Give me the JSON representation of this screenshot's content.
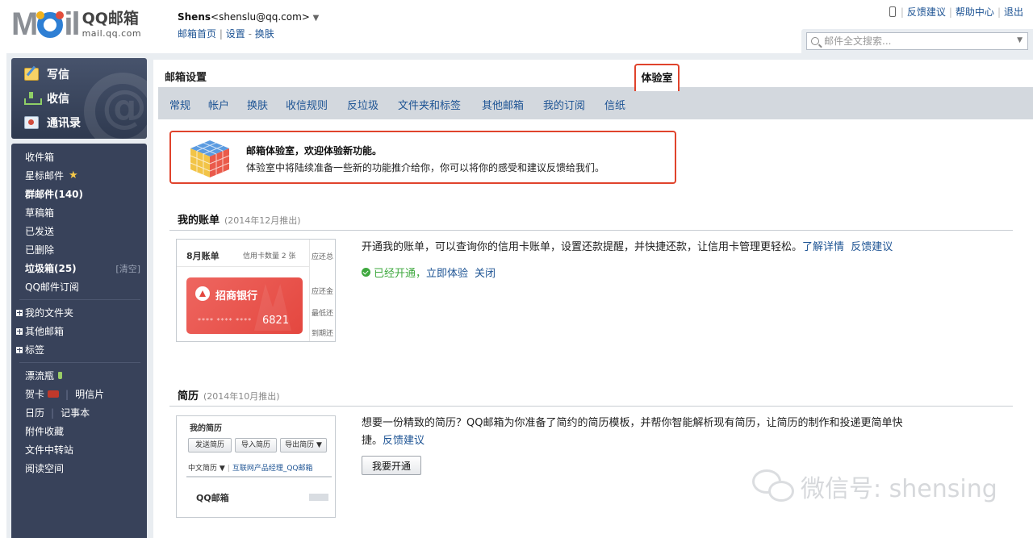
{
  "header": {
    "logo_mark": "M il",
    "logo_cn": "QQ邮箱",
    "logo_domain": "mail.qq.com",
    "user_name": "Shens",
    "user_email": "<shenslu@qq.com>",
    "user_arrow": "▼",
    "links": [
      "邮箱首页",
      "设置",
      "换肤"
    ],
    "link_seps": [
      "|",
      "-"
    ],
    "top_right": [
      "反馈建议",
      "帮助中心",
      "退出"
    ],
    "search_placeholder": "邮件全文搜索...",
    "search_dropdown": "▼"
  },
  "sidebar": {
    "primary": [
      {
        "label": "写信",
        "icon": "compose-icon"
      },
      {
        "label": "收信",
        "icon": "inbox-download-icon"
      },
      {
        "label": "通讯录",
        "icon": "contacts-icon"
      }
    ],
    "folders": [
      "收件箱",
      "星标邮件",
      "群邮件(140)",
      "草稿箱",
      "已发送",
      "已删除",
      "垃圾箱(25)",
      "QQ邮件订阅"
    ],
    "star_glyph": "★",
    "clear_label": "[清空]",
    "groups": [
      "我的文件夹",
      "其他邮箱",
      "标签"
    ],
    "tools": {
      "drift_bottle": "漂流瓶",
      "greeting_card": "贺卡",
      "postcard": "明信片",
      "calendar": "日历",
      "notes": "记事本",
      "attachments": "附件收藏",
      "file_transfer": "文件中转站",
      "reading_space": "阅读空间",
      "sep": "|"
    }
  },
  "main": {
    "title": "邮箱设置",
    "tabs": [
      "常规",
      "帐户",
      "换肤",
      "收信规则",
      "反垃圾",
      "文件夹和标签",
      "其他邮箱",
      "我的订阅",
      "信纸"
    ],
    "active_tab": "体验室",
    "intro": {
      "line1": "邮箱体验室，欢迎体验新功能。",
      "line2": "体验室中将陆续准备一些新的功能推介给你，你可以将你的感受和建议反馈给我们。"
    },
    "features": [
      {
        "title": "我的账单",
        "date": "(2014年12月推出)",
        "desc": "开通我的账单，可以查询你的信用卡账单，设置还款提醒，并快捷还款，让信用卡管理更轻松。",
        "links": [
          "了解详情",
          "反馈建议"
        ],
        "status": "已经开通，",
        "actions": [
          "立即体验",
          "关闭"
        ],
        "thumb": {
          "title": "8月账单",
          "count": "信用卡数量 2 张",
          "side": [
            "应还总",
            "应还金",
            "最低还",
            "到期还"
          ],
          "bank": "招商银行",
          "stars": "**** **** ****",
          "card_no": "6821"
        }
      },
      {
        "title": "简历",
        "date": "(2014年10月推出)",
        "desc_line1": "想要一份精致的简历？QQ邮箱为你准备了简约的简历模板，并帮你智能解析现有简历，让简历的制作和投递更简单快",
        "desc_line2": "捷。",
        "links": [
          "反馈建议"
        ],
        "button": "我要开通",
        "thumb": {
          "title": "我的简历",
          "buttons": [
            "发送简历",
            "导入简历",
            "导出简历 ▼"
          ],
          "lang": "中文简历 ▼",
          "sep": "|",
          "link": "互联网产品经理_QQ邮箱",
          "brand": "QQ邮箱"
        }
      }
    ]
  },
  "watermark": "微信号: shensing",
  "colors": {
    "accent": "#1e5494",
    "highlight": "#e0432c",
    "sidebar": "#38425a",
    "success": "#3ea83e"
  }
}
